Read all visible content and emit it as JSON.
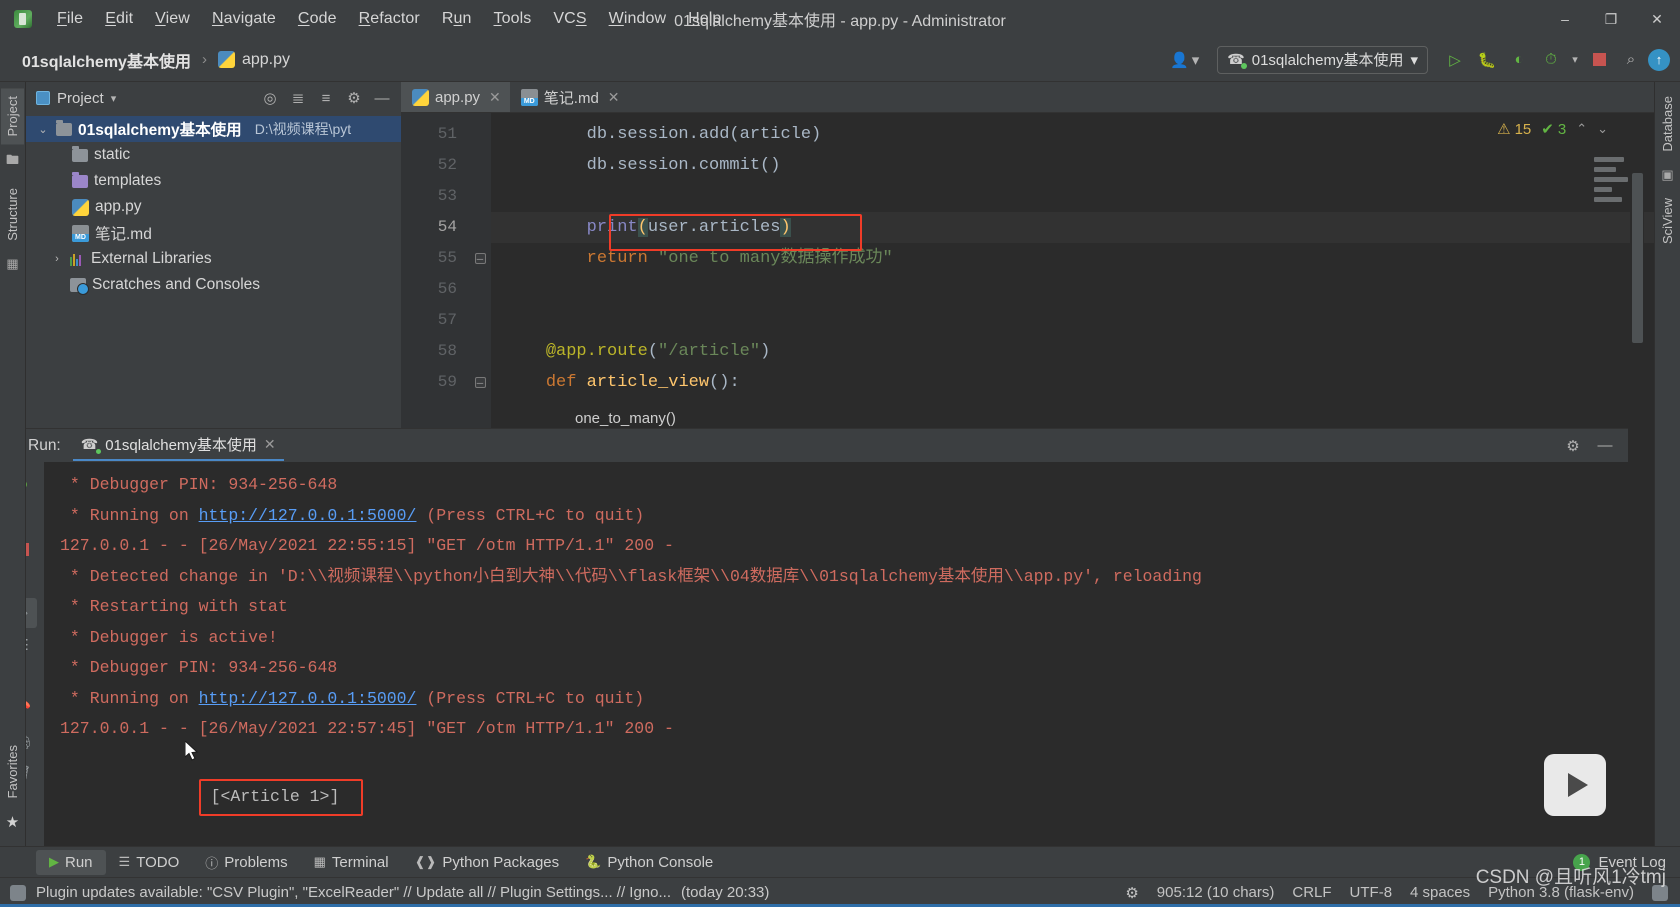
{
  "window": {
    "title": "01sqlalchemy基本使用 - app.py - Administrator",
    "minimize": "–",
    "maximize": "❐",
    "close": "✕"
  },
  "menubar": {
    "items": [
      "File",
      "Edit",
      "View",
      "Navigate",
      "Code",
      "Refactor",
      "Run",
      "Tools",
      "VCS",
      "Window",
      "Help"
    ]
  },
  "navbar": {
    "breadcrumb_project": "01sqlalchemy基本使用",
    "breadcrumb_sep": "›",
    "breadcrumb_file": "app.py",
    "run_config": "01sqlalchemy基本使用",
    "run_config_caret": "▾",
    "avatar_caret": "▾",
    "icons": {
      "avatar": "settings-sync-icon",
      "run": "run-icon",
      "debug": "debug-icon",
      "coverage": "run-with-coverage-icon",
      "profile": "profile-icon",
      "stop": "stop-icon",
      "search": "search-icon",
      "update": "update-icon"
    },
    "search_glyph": "⌕",
    "update_glyph": "↑"
  },
  "left_strip": {
    "tabs": [
      "Project",
      "Structure"
    ],
    "favorites": "Favorites",
    "star": "★"
  },
  "right_strip": {
    "tabs": [
      "Database",
      "SciView"
    ]
  },
  "project_panel": {
    "title": "Project",
    "caret": "▾",
    "tools": [
      "locate-icon",
      "expand-icon",
      "collapse-icon",
      "gear-icon",
      "hide-icon"
    ],
    "tree": [
      {
        "label": "01sqlalchemy基本使用",
        "path": "D:\\视频课程\\pyt",
        "icon": "folder",
        "indent": 0,
        "arrow": "⌄",
        "selected": true
      },
      {
        "label": "static",
        "path": "",
        "icon": "folder",
        "indent": 1,
        "arrow": "",
        "selected": false
      },
      {
        "label": "templates",
        "path": "",
        "icon": "folder-purple",
        "indent": 1,
        "arrow": "",
        "selected": false
      },
      {
        "label": "app.py",
        "path": "",
        "icon": "python-file",
        "indent": 1,
        "arrow": "",
        "selected": false
      },
      {
        "label": "笔记.md",
        "path": "",
        "icon": "markdown-file",
        "indent": 1,
        "arrow": "",
        "selected": false
      },
      {
        "label": "External Libraries",
        "path": "",
        "icon": "libraries",
        "indent": 0,
        "arrow": "›",
        "selected": false
      },
      {
        "label": "Scratches and Consoles",
        "path": "",
        "icon": "scratches",
        "indent": 0,
        "arrow": "",
        "selected": false
      }
    ]
  },
  "editor": {
    "tabs": [
      {
        "label": "app.py",
        "icon": "python-file",
        "active": true,
        "close": "✕"
      },
      {
        "label": "笔记.md",
        "icon": "markdown-file",
        "active": false,
        "close": "✕"
      }
    ],
    "lines": [
      {
        "no": "51",
        "text": "        db.session.add(article)"
      },
      {
        "no": "52",
        "text": "        db.session.commit()"
      },
      {
        "no": "53",
        "text": ""
      },
      {
        "no": "54",
        "text": "        print(user.articles)"
      },
      {
        "no": "55",
        "text": "        return \"one to many数据操作成功\""
      },
      {
        "no": "56",
        "text": ""
      },
      {
        "no": "57",
        "text": ""
      },
      {
        "no": "58",
        "text": "    @app.route(\"/article\")"
      },
      {
        "no": "59",
        "text": "    def article_view():"
      }
    ],
    "popup_hint": "one_to_many()",
    "inspections": {
      "warnings": "15",
      "warn_icon": "⚠",
      "checks": "3",
      "check_icon": "✔",
      "up": "⌃",
      "down": "⌄"
    },
    "highlight_line": "print(user.articles)"
  },
  "run_panel": {
    "label": "Run:",
    "tab_label": "01sqlalchemy基本使用",
    "tab_close": "✕",
    "tools": [
      "gear-icon",
      "hide-icon"
    ],
    "side_buttons": [
      "rerun-icon",
      "stop-icon",
      "up-icon",
      "down-icon",
      "soft-wrap-icon",
      "scroll-end-icon",
      "dump-threads-icon",
      "pin-icon",
      "print-icon",
      "clear-icon"
    ],
    "console": [
      {
        "parts": [
          {
            "t": " * Debugger PIN: 934-256-648",
            "k": "err"
          }
        ]
      },
      {
        "parts": [
          {
            "t": " * Running on ",
            "k": "err"
          },
          {
            "t": "http://127.0.0.1:5000/",
            "k": "link"
          },
          {
            "t": " (Press CTRL+C to quit)",
            "k": "err"
          }
        ]
      },
      {
        "parts": [
          {
            "t": "127.0.0.1 - - [26/May/2021 22:55:15] \"GET /otm HTTP/1.1\" 200 -",
            "k": "err"
          }
        ]
      },
      {
        "parts": [
          {
            "t": " * Detected change in 'D:\\\\视频课程\\\\python小白到大神\\\\代码\\\\flask框架\\\\04数据库\\\\01sqlalchemy基本使用\\\\app.py', reloading",
            "k": "err"
          }
        ]
      },
      {
        "parts": [
          {
            "t": " * Restarting with stat",
            "k": "err"
          }
        ]
      },
      {
        "parts": [
          {
            "t": " * Debugger is active!",
            "k": "err"
          }
        ]
      },
      {
        "parts": [
          {
            "t": " * Debugger PIN: 934-256-648",
            "k": "err"
          }
        ]
      },
      {
        "parts": [
          {
            "t": " * Running on ",
            "k": "err"
          },
          {
            "t": "http://127.0.0.1:5000/",
            "k": "link"
          },
          {
            "t": " (Press CTRL+C to quit)",
            "k": "err"
          }
        ]
      },
      {
        "parts": [
          {
            "t": "127.0.0.1 - - [26/May/2021 22:57:45] \"GET /otm HTTP/1.1\" 200 -",
            "k": "err"
          }
        ]
      }
    ],
    "highlighted_output": "[<Article 1>]"
  },
  "tool_windows": {
    "items": [
      {
        "label": "Run",
        "icon": "run-icon",
        "active": true
      },
      {
        "label": "TODO",
        "icon": "todo-icon",
        "active": false
      },
      {
        "label": "Problems",
        "icon": "problems-icon",
        "active": false
      },
      {
        "label": "Terminal",
        "icon": "terminal-icon",
        "active": false
      },
      {
        "label": "Python Packages",
        "icon": "packages-icon",
        "active": false
      },
      {
        "label": "Python Console",
        "icon": "python-console-icon",
        "active": false
      }
    ],
    "event_log": "Event Log",
    "event_count": "1"
  },
  "statusbar": {
    "message": "Plugin updates available: \"CSV Plugin\", \"ExcelReader\" // Update all // Plugin Settings... // Igno...",
    "timestamp": "(today 20:33)",
    "caret_position": "905:12 (10 chars)",
    "line_separator": "CRLF",
    "encoding": "UTF-8",
    "indent": "4 spaces",
    "interpreter": "Python 3.8 (flask-env)",
    "lock_icon": "lock-icon"
  },
  "watermark": "CSDN @且听风1冷tmj",
  "colors": {
    "accent_blue": "#3592c4",
    "run_green": "#62b543",
    "error_red": "#cf6b5f",
    "highlight_red": "#f03c28",
    "panel_bg": "#3c3f41",
    "editor_bg": "#2b2b2b",
    "selection_blue": "#2f4a70"
  }
}
